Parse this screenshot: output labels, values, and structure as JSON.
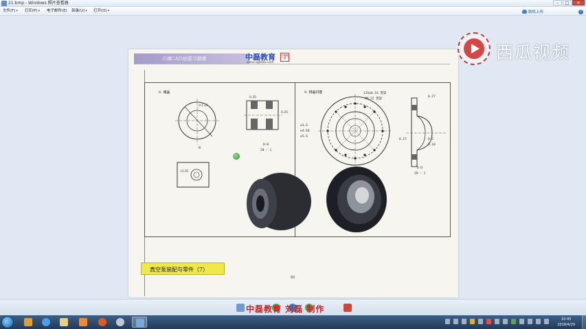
{
  "window": {
    "title": "21.bmp - Windows 照片查看器",
    "minimize": "–",
    "maximize": "□",
    "close": "✕"
  },
  "menu": {
    "items": [
      {
        "label": "文件(F)"
      },
      {
        "label": "打印(P)"
      },
      {
        "label": "电子邮件(E)"
      },
      {
        "label": "刻录(U)"
      },
      {
        "label": "打开(O)"
      }
    ],
    "cloud_upload": "联机上传"
  },
  "page": {
    "header_text": "三维CAD绘图习题集",
    "logo_text": "中磊教育",
    "logo_url": "www.ugboke.com",
    "logo_seal": "中磊教育",
    "left_title": "6. 堵盖",
    "right_title": "9. 排盖衬套",
    "section_left": "B-B",
    "scale_left": "20 : 1",
    "section_right": "D-D",
    "scale_right": "20 : 1",
    "caption": "真空泵装配与零件（7）",
    "page_number": "82",
    "dims": [
      "R0.35",
      "0.35",
      "12X∅0.16 贯穿",
      "M0.22 贯穿",
      "∅3.6",
      "∅4.68",
      "∅5.6",
      "∅1.92",
      "∅1.25",
      "0.27",
      "0.2",
      "0.18",
      "0.15"
    ]
  },
  "site_logo": {
    "name": "西瓜视频"
  },
  "subtitle": "中磊教育 刘磊 制作",
  "taskbar": {
    "time": "10:45",
    "date": "2018/4/29"
  }
}
